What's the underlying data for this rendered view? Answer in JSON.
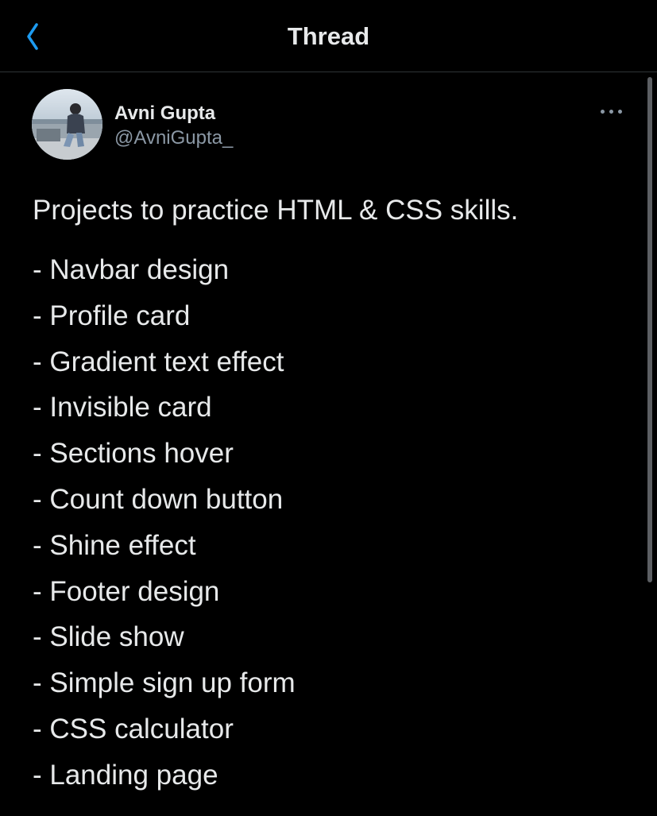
{
  "header": {
    "title": "Thread",
    "back_icon": "chevron-left-icon",
    "accent_color": "#1d9bf0"
  },
  "tweet": {
    "author": {
      "name": "Avni Gupta",
      "handle": "@AvniGupta_"
    },
    "more_icon": "more-horizontal-icon",
    "intro": "Projects to practice HTML & CSS skills.",
    "items": [
      "- Navbar design",
      "- Profile card",
      "- Gradient text effect",
      "- Invisible card",
      "- Sections hover",
      "- Count down button",
      "- Shine effect",
      "- Footer design",
      "- Slide show",
      "- Simple sign up form",
      "- CSS calculator",
      "- Landing page"
    ]
  },
  "colors": {
    "background": "#000000",
    "text": "#e7e9ea",
    "secondary_text": "#8b98a5",
    "divider": "#2f3336"
  }
}
